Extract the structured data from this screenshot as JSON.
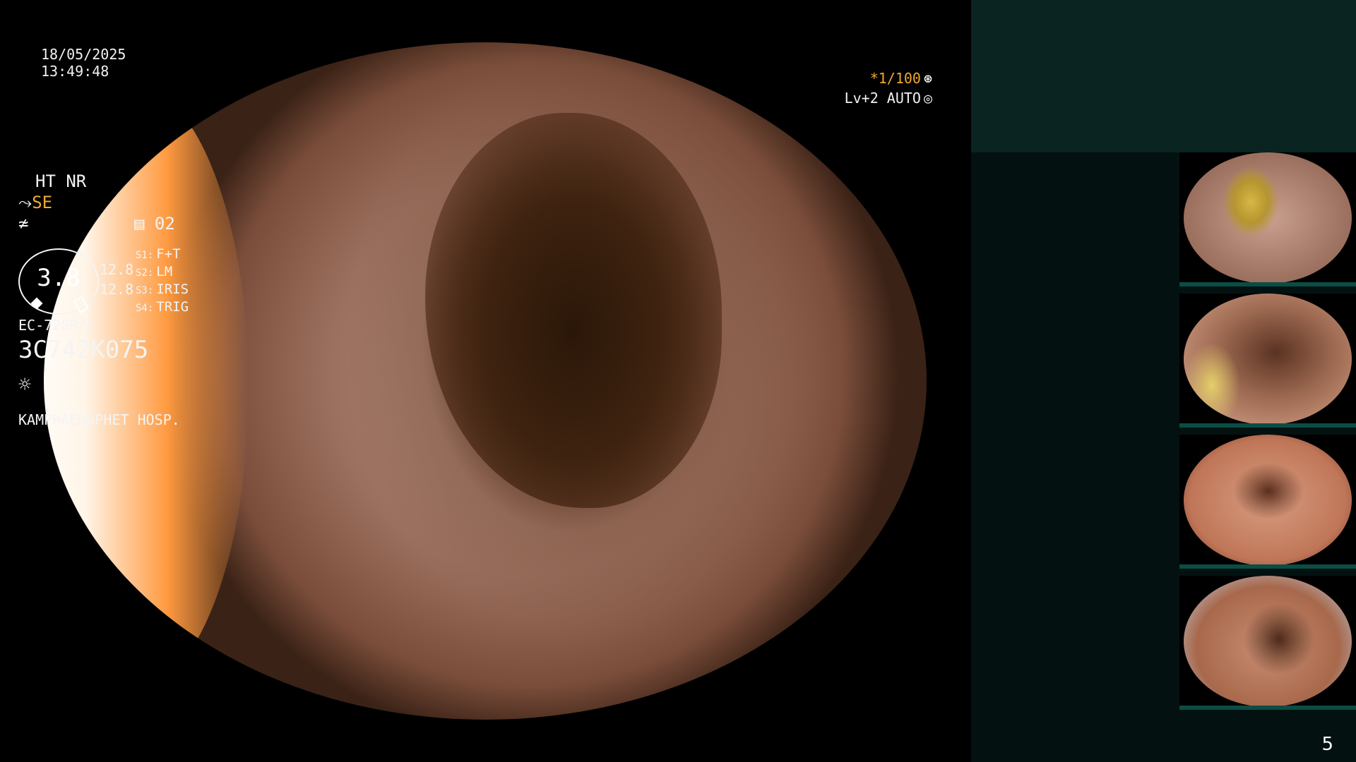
{
  "overlay": {
    "date": "18/05/2025",
    "time": "13:49:48",
    "shutter": "*1/100",
    "shutter_icon": "⊛",
    "level": "Lv+2 AUTO",
    "level_icon": "◎"
  },
  "panel": {
    "mode": "HT NR",
    "se_prefix": "⤳",
    "se_label": "SE",
    "filter_icon": "≄",
    "channel": "▤ 02",
    "gauge_value": "3.8",
    "value_a": "12.8",
    "value_b": "12.8",
    "switches": [
      {
        "key": "S1:",
        "value": "F+T"
      },
      {
        "key": "S2:",
        "value": "LM"
      },
      {
        "key": "S3:",
        "value": "IRIS"
      },
      {
        "key": "S4:",
        "value": "TRIG"
      }
    ],
    "model": "EC-720R/L",
    "serial": "3C742K075",
    "light_icon": "☼",
    "hospital": "KAMPHAENGPHET HOSP."
  },
  "thumbnails": [
    "thumb-1",
    "thumb-2",
    "thumb-3",
    "thumb-4"
  ],
  "page_number": "5",
  "colors": {
    "accent": "#f0a830",
    "panel_bg": "#031210",
    "panel_header": "#0a2421",
    "thumb_bar": "#0b4d45"
  }
}
